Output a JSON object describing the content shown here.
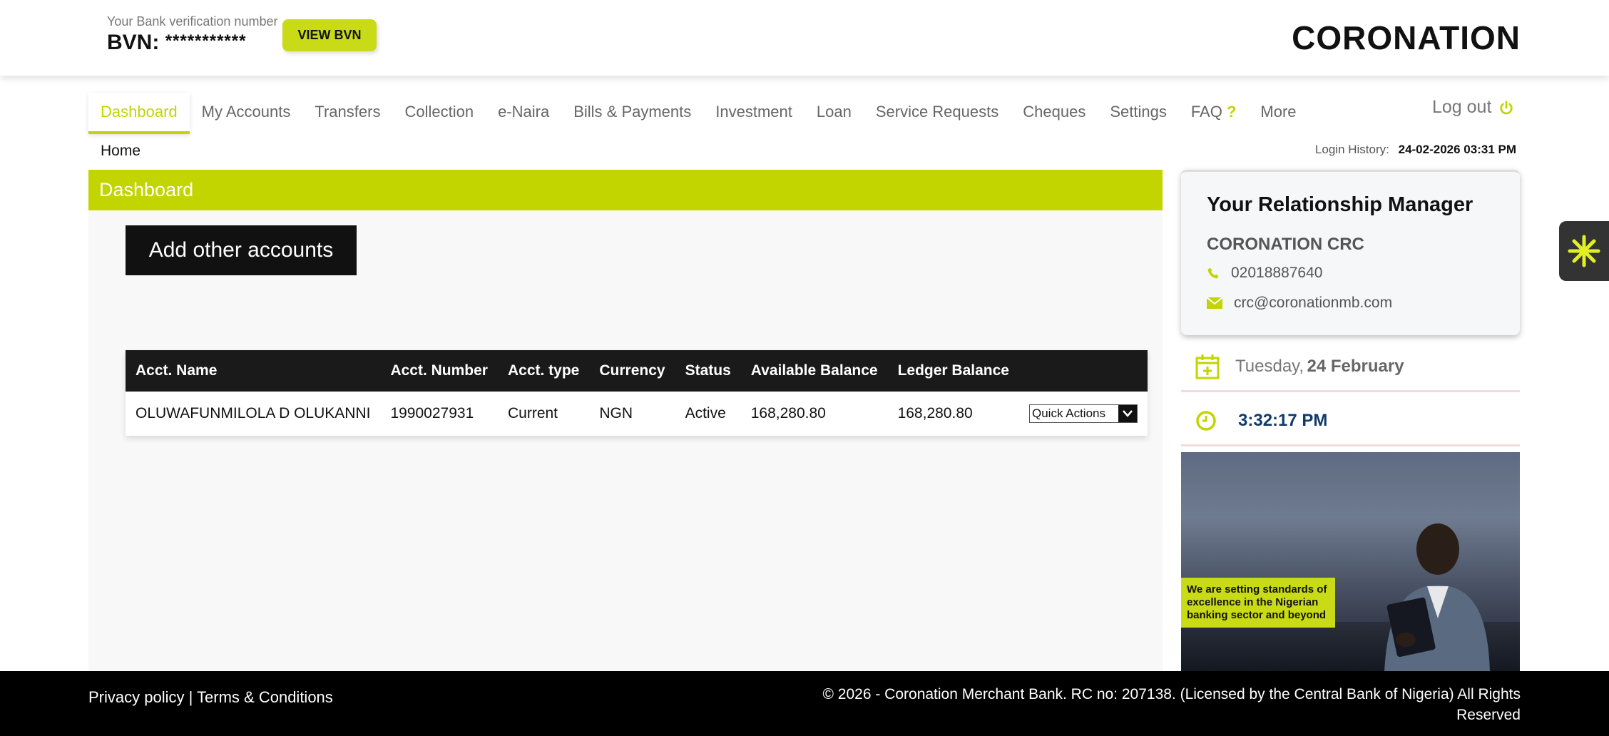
{
  "header": {
    "bvn_caption": "Your Bank verification number",
    "bvn_label": "BVN:",
    "bvn_mask": "***********",
    "view_bvn_label": "VIEW BVN",
    "brand": "CORONATION"
  },
  "nav": {
    "items": [
      {
        "label": "Dashboard"
      },
      {
        "label": "My Accounts"
      },
      {
        "label": "Transfers"
      },
      {
        "label": "Collection"
      },
      {
        "label": "e-Naira"
      },
      {
        "label": "Bills & Payments"
      },
      {
        "label": "Investment"
      },
      {
        "label": "Loan"
      },
      {
        "label": "Service Requests"
      },
      {
        "label": "Cheques"
      },
      {
        "label": "Settings"
      },
      {
        "label": "FAQ"
      },
      {
        "label": "More"
      }
    ],
    "faq_mark": "?",
    "logout_label": "Log out"
  },
  "breadcrumb": "Home",
  "login_history": {
    "label": "Login History:",
    "value": "24-02-2026 03:31 PM"
  },
  "main": {
    "title": "Dashboard",
    "add_accounts_label": "Add other accounts",
    "table": {
      "headers": [
        "Acct. Name",
        "Acct. Number",
        "Acct. type",
        "Currency",
        "Status",
        "Available Balance",
        "Ledger Balance",
        ""
      ],
      "rows": [
        {
          "name": "OLUWAFUNMILOLA D OLUKANNI",
          "number": "1990027931",
          "type": "Current",
          "currency": "NGN",
          "status": "Active",
          "available": "168,280.80",
          "ledger": "168,280.80",
          "action": "Quick Actions"
        }
      ]
    }
  },
  "relationship_manager": {
    "title": "Your Relationship Manager",
    "name": "CORONATION CRC",
    "phone": "02018887640",
    "email": "crc@coronationmb.com"
  },
  "date_widget": {
    "day": "Tuesday",
    "separator": ",",
    "date": "24 February"
  },
  "time_widget": {
    "time": "3:32:17 PM"
  },
  "promo": {
    "text": "We are setting standards of excellence in the Nigerian banking sector and beyond"
  },
  "footer": {
    "privacy": "Privacy policy",
    "divider": "|",
    "terms": "Terms & Conditions",
    "copyright": "© 2026 - Coronation Merchant Bank. RC no: 207138. (Licensed by the Central Bank of Nigeria) All Rights Reserved"
  },
  "colors": {
    "accent": "#c2d500",
    "button": "#c9db16",
    "dark": "#111111",
    "time": "#0f3b6c"
  }
}
